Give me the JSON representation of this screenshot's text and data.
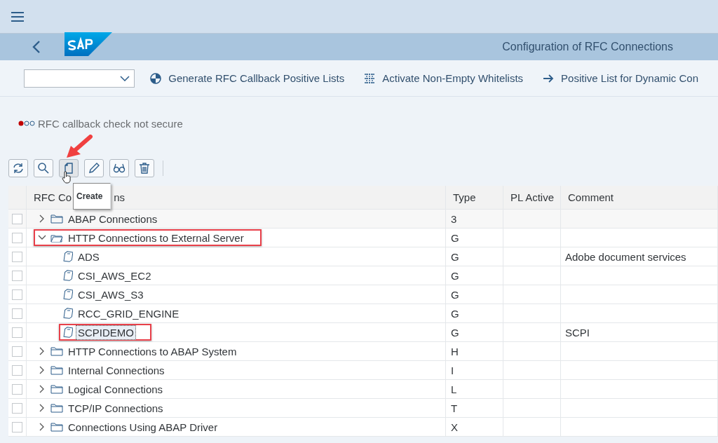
{
  "header": {
    "title": "Configuration of RFC Connections"
  },
  "toolbar": {
    "actions": [
      {
        "label": "Generate RFC Callback Positive Lists",
        "kind": "pie"
      },
      {
        "label": "Activate Non-Empty Whitelists",
        "kind": "grid"
      },
      {
        "label": "Positive List for Dynamic Con",
        "kind": "arrow"
      }
    ]
  },
  "status": {
    "lights": [
      {
        "on": true,
        "color": "#c00000"
      },
      {
        "on": false
      },
      {
        "on": false
      }
    ],
    "text": "RFC callback check not secure"
  },
  "table_tools": [
    {
      "kind": "refresh",
      "hovered": false
    },
    {
      "kind": "search",
      "hovered": false
    },
    {
      "kind": "create",
      "hovered": true
    },
    {
      "kind": "edit",
      "hovered": false
    },
    {
      "kind": "display",
      "hovered": false
    },
    {
      "kind": "delete",
      "hovered": false
    }
  ],
  "tooltip": {
    "text": "Create"
  },
  "table": {
    "columns": [
      {
        "label": "RFC Co",
        "label_after_tooltip": "ns"
      },
      {
        "label": "Type"
      },
      {
        "label": "PL Active"
      },
      {
        "label": "Comment"
      }
    ],
    "rows": [
      {
        "name": "ABAP Connections",
        "type": "3",
        "kind": "folder",
        "expanded": false,
        "highlighted": true,
        "annotated": false,
        "focused": false,
        "checked": false
      },
      {
        "name": "HTTP Connections to External Server",
        "type": "G",
        "kind": "folder",
        "expanded": true,
        "highlighted": false,
        "annotated": true,
        "focused": false,
        "checked": false,
        "children": [
          {
            "name": "ADS",
            "type": "G",
            "comment": "Adobe document services",
            "kind": "connection",
            "highlighted": false,
            "annotated": false,
            "focused": false,
            "checked": false
          },
          {
            "name": "CSI_AWS_EC2",
            "type": "G",
            "kind": "connection",
            "highlighted": false,
            "annotated": false,
            "focused": false,
            "checked": false
          },
          {
            "name": "CSI_AWS_S3",
            "type": "G",
            "kind": "connection",
            "highlighted": false,
            "annotated": false,
            "focused": false,
            "checked": false
          },
          {
            "name": "RCC_GRID_ENGINE",
            "type": "G",
            "kind": "connection",
            "highlighted": false,
            "annotated": false,
            "focused": false,
            "checked": false
          },
          {
            "name": "SCPIDEMO",
            "type": "G",
            "comment": "SCPI",
            "kind": "connection",
            "highlighted": false,
            "annotated": true,
            "focused": true,
            "checked": false
          }
        ]
      },
      {
        "name": "HTTP Connections to ABAP System",
        "type": "H",
        "kind": "folder",
        "expanded": false,
        "highlighted": false,
        "annotated": false,
        "focused": false,
        "checked": false
      },
      {
        "name": "Internal Connections",
        "type": "I",
        "kind": "folder",
        "expanded": false,
        "highlighted": false,
        "annotated": false,
        "focused": false,
        "checked": false
      },
      {
        "name": "Logical Connections",
        "type": "L",
        "kind": "folder",
        "expanded": false,
        "highlighted": false,
        "annotated": false,
        "focused": false,
        "checked": false
      },
      {
        "name": "TCP/IP Connections",
        "type": "T",
        "kind": "folder",
        "expanded": false,
        "highlighted": false,
        "annotated": false,
        "focused": false,
        "checked": false
      },
      {
        "name": "Connections Using ABAP Driver",
        "type": "X",
        "kind": "folder",
        "expanded": false,
        "highlighted": false,
        "annotated": false,
        "focused": false,
        "checked": false
      }
    ]
  }
}
